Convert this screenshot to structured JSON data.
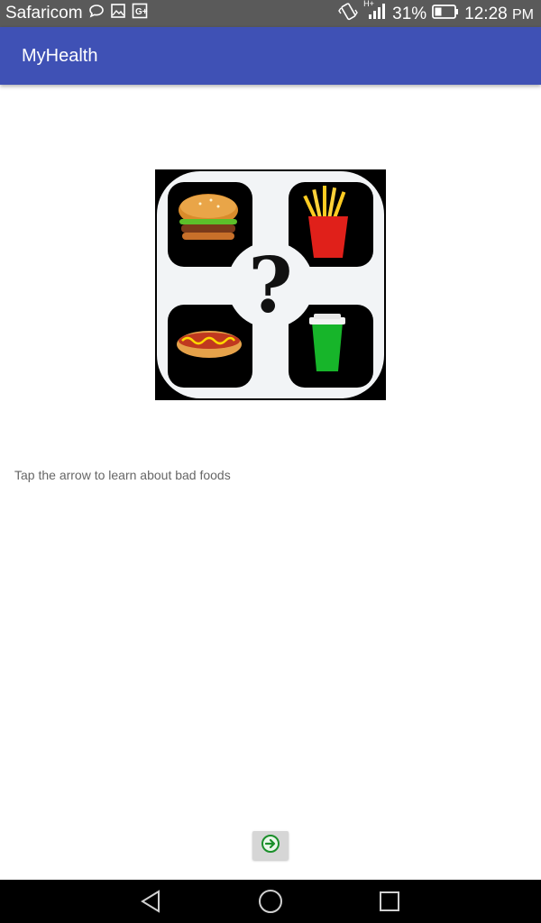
{
  "status_bar": {
    "carrier": "Safaricom",
    "network_type": "H+",
    "battery_percent": "31%",
    "time": "12:28",
    "time_suffix": "PM",
    "icons": [
      "message-icon",
      "gallery-icon",
      "google-plus-icon",
      "vibrate-icon",
      "signal-icon",
      "battery-icon"
    ]
  },
  "app_bar": {
    "title": "MyHealth"
  },
  "main": {
    "hero_image": "junk-food-quiz-icon",
    "hero_symbol": "?",
    "hint_text": "Tap the arrow to learn about bad foods",
    "next_button_icon": "arrow-right-circle-icon"
  },
  "nav_bar": {
    "icons": [
      "back-icon",
      "home-icon",
      "recents-icon"
    ]
  },
  "colors": {
    "app_bar": "#3f51b5",
    "status_bar": "#5a5a5a",
    "nav_bar": "#000000",
    "arrow": "#1a8f2a"
  }
}
